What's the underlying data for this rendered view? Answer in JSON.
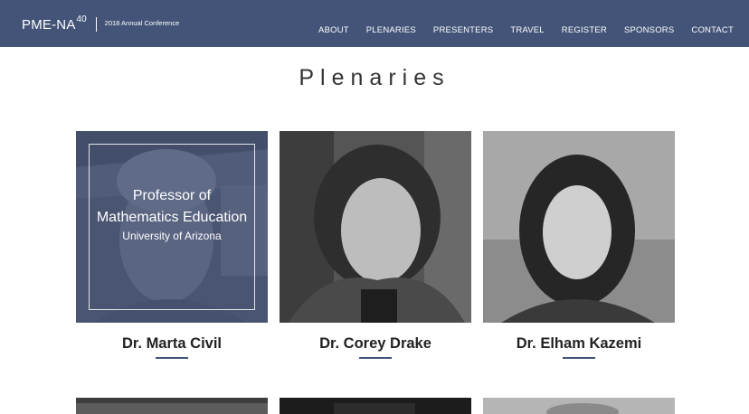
{
  "header": {
    "brand_name": "PME-NA",
    "brand_sup": "40",
    "tagline": "2018 Annual Conference",
    "nav": [
      "ABOUT",
      "PLENARIES",
      "PRESENTERS",
      "TRAVEL",
      "REGISTER",
      "SPONSORS",
      "CONTACT"
    ]
  },
  "page": {
    "title": "Plenaries"
  },
  "plenaries": [
    {
      "name": "Dr. Marta Civil",
      "overlay_title_line1": "Professor of",
      "overlay_title_line2": "Mathematics Education",
      "overlay_subtitle": "University of Arizona"
    },
    {
      "name": "Dr. Corey Drake"
    },
    {
      "name": "Dr. Elham Kazemi"
    }
  ],
  "colors": {
    "header_bg": "#435478",
    "accent": "#435478",
    "text": "#222222"
  }
}
